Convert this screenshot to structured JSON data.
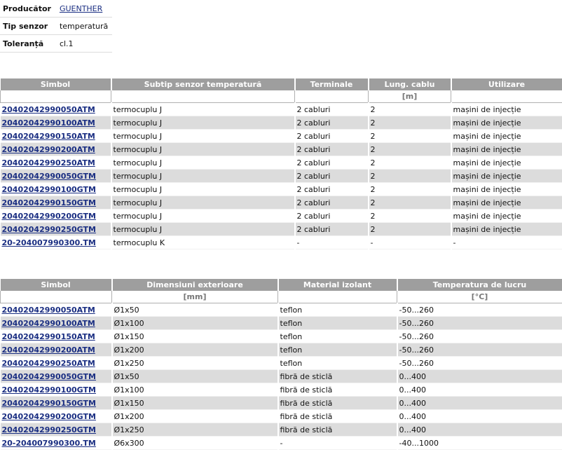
{
  "specs": [
    {
      "label": "Producător",
      "value": "GUENTHER",
      "link": true
    },
    {
      "label": "Tip senzor",
      "value": "temperatură",
      "link": false
    },
    {
      "label": "Toleranță",
      "value": "cl.1",
      "link": false
    }
  ],
  "table1": {
    "headers": [
      "Simbol",
      "Subtip senzor temperatură",
      "Terminale",
      "Lung. cablu",
      "Utilizare"
    ],
    "units": [
      "",
      "",
      "",
      "[m]",
      ""
    ],
    "rows": [
      [
        "20402042990050ATM",
        "termocuplu J",
        "2 cabluri",
        "2",
        "mașini de injecție"
      ],
      [
        "20402042990100ATM",
        "termocuplu J",
        "2 cabluri",
        "2",
        "mașini de injecție"
      ],
      [
        "20402042990150ATM",
        "termocuplu J",
        "2 cabluri",
        "2",
        "mașini de injecție"
      ],
      [
        "20402042990200ATM",
        "termocuplu J",
        "2 cabluri",
        "2",
        "mașini de injecție"
      ],
      [
        "20402042990250ATM",
        "termocuplu J",
        "2 cabluri",
        "2",
        "mașini de injecție"
      ],
      [
        "20402042990050GTM",
        "termocuplu J",
        "2 cabluri",
        "2",
        "mașini de injecție"
      ],
      [
        "20402042990100GTM",
        "termocuplu J",
        "2 cabluri",
        "2",
        "mașini de injecție"
      ],
      [
        "20402042990150GTM",
        "termocuplu J",
        "2 cabluri",
        "2",
        "mașini de injecție"
      ],
      [
        "20402042990200GTM",
        "termocuplu J",
        "2 cabluri",
        "2",
        "mașini de injecție"
      ],
      [
        "20402042990250GTM",
        "termocuplu J",
        "2 cabluri",
        "2",
        "mașini de injecție"
      ],
      [
        "20-204007990300.TM",
        "termocuplu K",
        "-",
        "-",
        "-"
      ]
    ]
  },
  "table2": {
    "headers": [
      "Simbol",
      "Dimensiuni exterioare",
      "Material izolant",
      "Temperatura de lucru"
    ],
    "units": [
      "",
      "[mm]",
      "",
      "[°C]"
    ],
    "rows": [
      [
        "20402042990050ATM",
        "Ø1x50",
        "teflon",
        "-50...260"
      ],
      [
        "20402042990100ATM",
        "Ø1x100",
        "teflon",
        "-50...260"
      ],
      [
        "20402042990150ATM",
        "Ø1x150",
        "teflon",
        "-50...260"
      ],
      [
        "20402042990200ATM",
        "Ø1x200",
        "teflon",
        "-50...260"
      ],
      [
        "20402042990250ATM",
        "Ø1x250",
        "teflon",
        "-50...260"
      ],
      [
        "20402042990050GTM",
        "Ø1x50",
        "fibră de sticlă",
        "0...400"
      ],
      [
        "20402042990100GTM",
        "Ø1x100",
        "fibră de sticlă",
        "0...400"
      ],
      [
        "20402042990150GTM",
        "Ø1x150",
        "fibră de sticlă",
        "0...400"
      ],
      [
        "20402042990200GTM",
        "Ø1x200",
        "fibră de sticlă",
        "0...400"
      ],
      [
        "20402042990250GTM",
        "Ø1x250",
        "fibră de sticlă",
        "0...400"
      ],
      [
        "20-204007990300.TM",
        "Ø6x300",
        "-",
        "-40...1000"
      ]
    ]
  }
}
